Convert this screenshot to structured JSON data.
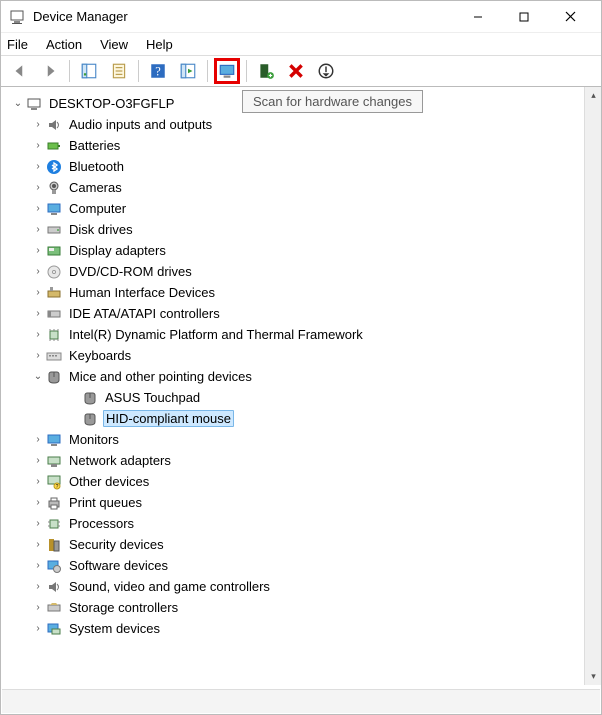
{
  "window": {
    "title": "Device Manager"
  },
  "menu": {
    "file": "File",
    "action": "Action",
    "view": "View",
    "help": "Help"
  },
  "tooltip": "Scan for hardware changes",
  "root": {
    "name": "DESKTOP-O3FGFLP"
  },
  "categories": {
    "audio": "Audio inputs and outputs",
    "batteries": "Batteries",
    "bluetooth": "Bluetooth",
    "cameras": "Cameras",
    "computer": "Computer",
    "disk": "Disk drives",
    "display": "Display adapters",
    "dvd": "DVD/CD-ROM drives",
    "hid": "Human Interface Devices",
    "ide": "IDE ATA/ATAPI controllers",
    "intel": "Intel(R) Dynamic Platform and Thermal Framework",
    "keyboards": "Keyboards",
    "mice": "Mice and other pointing devices",
    "monitors": "Monitors",
    "network": "Network adapters",
    "other": "Other devices",
    "print": "Print queues",
    "processors": "Processors",
    "security": "Security devices",
    "software": "Software devices",
    "sound": "Sound, video and game controllers",
    "storage": "Storage controllers",
    "system": "System devices"
  },
  "mice_children": {
    "asus": "ASUS Touchpad",
    "hid": "HID-compliant mouse"
  }
}
